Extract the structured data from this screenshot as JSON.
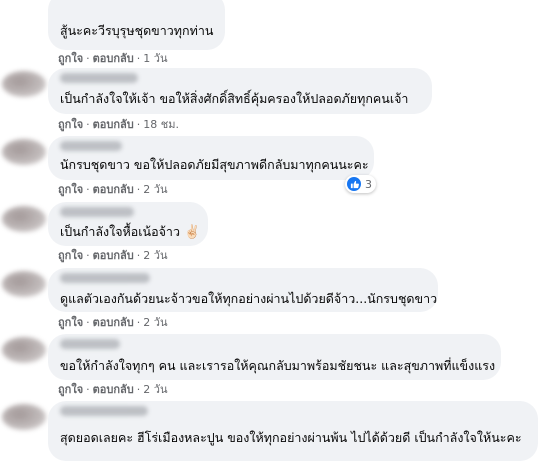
{
  "comments": [
    {
      "text": "สู้นะคะวีรบุรุษชุดขาวทุกท่าน",
      "like_label": "ถูกใจ",
      "reply_label": "ตอบกลับ",
      "time": "1 วัน"
    },
    {
      "text": "เป็นกำลังใจให้เจ้า ขอให้สิ่งศักดิ์สิทธิ์คุ้มครองให้ปลอดภัยทุกคนเจ้า",
      "like_label": "ถูกใจ",
      "reply_label": "ตอบกลับ",
      "time": "18 ชม."
    },
    {
      "text": "นักรบชุดขาว ขอให้ปลอดภัยมีสุขภาพดีกลับมาทุกคนนะคะ",
      "like_label": "ถูกใจ",
      "reply_label": "ตอบกลับ",
      "time": "2 วัน",
      "reaction_count": "3"
    },
    {
      "text": "เป็นกำลังใจหื้อเน้อจ้าว",
      "emoji": "✌🏻",
      "like_label": "ถูกใจ",
      "reply_label": "ตอบกลับ",
      "time": "2 วัน"
    },
    {
      "text": "ดูแลตัวเองกันด้วยนะจ้าวขอให้ทุกอย่างผ่านไปด้วยดีจ้าว...นักรบชุดขาว",
      "like_label": "ถูกใจ",
      "reply_label": "ตอบกลับ",
      "time": "2 วัน"
    },
    {
      "text": "ขอให้กำลังใจทุกๆ คน และเรารอให้คุณกลับมาพร้อมชัยชนะ และสุขภาพที่แข็งแรง",
      "like_label": "ถูกใจ",
      "reply_label": "ตอบกลับ",
      "time": "2 วัน"
    },
    {
      "text": "สุดยอดเลยคะ ฮีโร่เมืองหละปูน ของให้ทุกอย่างผ่านพ้น ไปได้ด้วยดี เป็นกำลังใจให้นะคะ"
    }
  ],
  "colors": {
    "bubble_bg": "#f0f2f5",
    "meta_text": "#65676b",
    "comment_text": "#050505",
    "like_blue": "#1877f2"
  },
  "icons": {
    "reaction": "like-thumbs-up-icon"
  }
}
